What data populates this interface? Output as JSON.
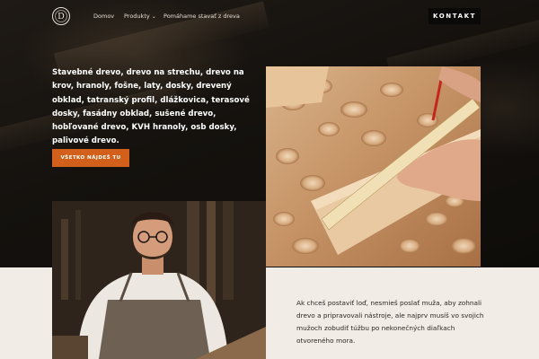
{
  "nav": {
    "logo_letter": "D",
    "items": [
      {
        "label": "Domov"
      },
      {
        "label": "Produkty"
      },
      {
        "label": "Pomáhame stavať z dreva"
      }
    ],
    "contact_label": "KONTAKT"
  },
  "hero": {
    "text": "Stavebné drevo, drevo na strechu, drevo na krov, hranoly, fošne, laty, dosky, drevený obklad, tatranský profil, dlážkovica, terasové dosky, fasádny obklad, sušené drevo, hobľované drevo, KVH hranoly, osb dosky, palivové drevo.",
    "cta_label": "VŠETKO NÁJDEŠ TU"
  },
  "about": {
    "text": "Ak chceš postaviť loď, nesmieš poslať muža, aby zohnali drevo a pripravovali nástroje, ale najprv musíš vo svojich mužoch zobudiť túžbu po nekonečných diaľkach otvoreného mora."
  },
  "colors": {
    "accent": "#d2601a",
    "contact_bg": "#0b0908",
    "section_bg": "#f1ede6"
  }
}
